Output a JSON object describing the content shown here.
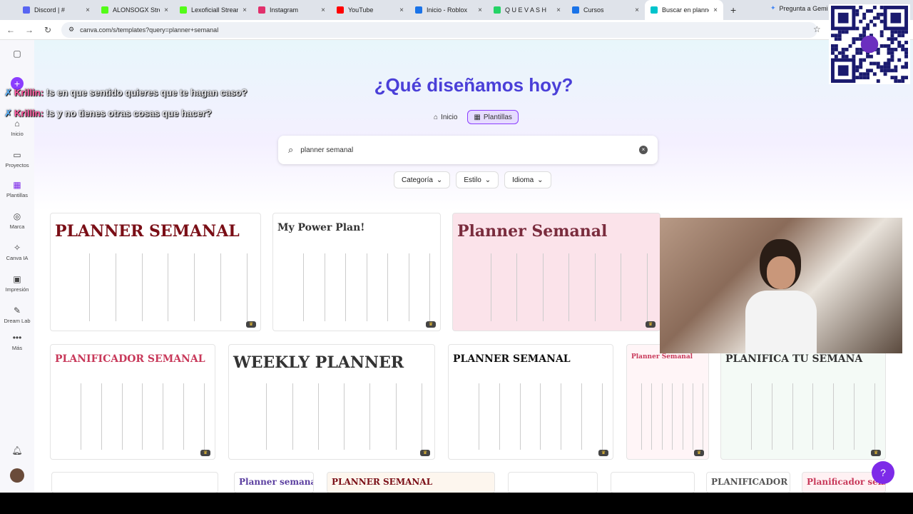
{
  "browser": {
    "tabs": [
      {
        "label": "Discord | #",
        "color": "#5865f2"
      },
      {
        "label": "ALONSOGX Strea",
        "color": "#53fc18"
      },
      {
        "label": "Lexoficiall Stream",
        "color": "#53fc18"
      },
      {
        "label": "Instagram",
        "color": "#e1306c"
      },
      {
        "label": "YouTube",
        "color": "#ff0000"
      },
      {
        "label": "Inicio - Roblox",
        "color": "#1a73e8"
      },
      {
        "label": "Q U E V A S H",
        "color": "#25d366"
      },
      {
        "label": "Cursos",
        "color": "#1a73e8"
      },
      {
        "label": "Buscar en planne",
        "color": "#00c4cc",
        "active": true
      }
    ],
    "gemini_tab": "Pregunta a Gemi",
    "url": "canva.com/s/templates?query=planner+semanal"
  },
  "sidebar": {
    "items": [
      {
        "label": "Inicio",
        "icon": "home-icon"
      },
      {
        "label": "Proyectos",
        "icon": "folder-icon"
      },
      {
        "label": "Plantillas",
        "icon": "templates-icon",
        "active": true
      },
      {
        "label": "Marca",
        "icon": "brand-icon"
      },
      {
        "label": "Canva IA",
        "icon": "ai-icon"
      },
      {
        "label": "Impresión",
        "icon": "print-icon"
      },
      {
        "label": "Dream Lab",
        "icon": "dreamlab-icon"
      },
      {
        "label": "Más",
        "icon": "more-icon"
      }
    ]
  },
  "hero": {
    "title": "¿Qué diseñamos hoy?",
    "pills": [
      {
        "label": "Inicio",
        "selected": false
      },
      {
        "label": "Plantillas",
        "selected": true
      }
    ],
    "search_value": "planner semanal",
    "filters": [
      "Categoría",
      "Estilo",
      "Idioma"
    ]
  },
  "chat": [
    {
      "user": "Krillin:",
      "text": "!s en que sentido quieres que te hagan caso?"
    },
    {
      "user": "Krillin:",
      "text": "!s y no tienes otras cosas que hacer?"
    }
  ],
  "cards": [
    {
      "title": "PLANNER SEMANAL",
      "bg": "#ffffff",
      "title_color": "#7a0e16"
    },
    {
      "title": "My Power Plan!",
      "bg": "#ffffff",
      "title_color": "#333333"
    },
    {
      "title": "Planner Semanal",
      "bg": "#fbe3ea",
      "title_color": "#7a2c3d"
    },
    {
      "title": "PLANIFICADOR SEMANAL",
      "bg": "#ffffff",
      "title_color": "#c8395a"
    },
    {
      "title": "WEEKLY PLANNER",
      "bg": "#ffffff",
      "title_color": "#333333"
    },
    {
      "title": "PLANNER SEMANAL",
      "bg": "#ffffff",
      "title_color": "#111111"
    },
    {
      "title": "Planner Semanal",
      "bg": "#fff5f7",
      "title_color": "#c8395a"
    },
    {
      "title": "PLANIFICA TU SEMANA",
      "bg": "#f4faf6",
      "title_color": "#333333"
    },
    {
      "title": "",
      "bg": "#ffffff",
      "title_color": "#333333"
    },
    {
      "title": "Planner semanal",
      "bg": "#ffffff",
      "title_color": "#5b3fa0"
    },
    {
      "title": "PLANNER SEMANAL",
      "bg": "#fdf6ee",
      "title_color": "#7a0e16"
    },
    {
      "title": "",
      "bg": "#ffffff",
      "title_color": "#333333"
    },
    {
      "title": "",
      "bg": "#ffffff",
      "title_color": "#333333"
    },
    {
      "title": "PLANIFICADOR",
      "bg": "#ffffff",
      "title_color": "#555555"
    },
    {
      "title": "Planificador semanal",
      "bg": "#fff1f3",
      "title_color": "#c8395a"
    }
  ],
  "help_label": "?"
}
